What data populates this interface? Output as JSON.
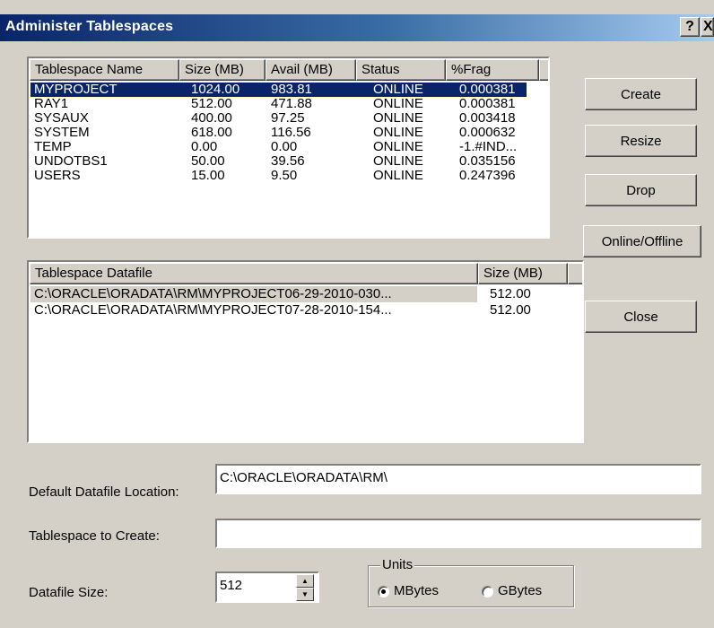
{
  "window": {
    "title": "Administer Tablespaces",
    "help_icon_glyph": "?",
    "close_icon_glyph": "X"
  },
  "tablespaces": {
    "columns": [
      "Tablespace Name",
      "Size (MB)",
      "Avail (MB)",
      "Status",
      "%Frag"
    ],
    "rows": [
      [
        "MYPROJECT",
        "1024.00",
        "983.81",
        "ONLINE",
        "0.000381"
      ],
      [
        "RAY1",
        "512.00",
        "471.88",
        "ONLINE",
        "0.000381"
      ],
      [
        "SYSAUX",
        "400.00",
        "97.25",
        "ONLINE",
        "0.003418"
      ],
      [
        "SYSTEM",
        "618.00",
        "116.56",
        "ONLINE",
        "0.000632"
      ],
      [
        "TEMP",
        "0.00",
        "0.00",
        "ONLINE",
        "-1.#IND..."
      ],
      [
        "UNDOTBS1",
        "50.00",
        "39.56",
        "ONLINE",
        "0.035156"
      ],
      [
        "USERS",
        "15.00",
        "9.50",
        "ONLINE",
        "0.247396"
      ]
    ],
    "selected_index": 0
  },
  "datafiles": {
    "columns": [
      "Tablespace Datafile",
      "Size (MB)"
    ],
    "rows": [
      [
        "C:\\ORACLE\\ORADATA\\RM\\MYPROJECT06-29-2010-030...",
        "512.00"
      ],
      [
        "C:\\ORACLE\\ORADATA\\RM\\MYPROJECT07-28-2010-154...",
        "512.00"
      ]
    ]
  },
  "buttons": {
    "create": "Create",
    "resize": "Resize",
    "drop": "Drop",
    "online_offline": "Online/Offline",
    "close": "Close"
  },
  "form": {
    "default_location_label": "Default Datafile Location:",
    "default_location_value": "C:\\ORACLE\\ORADATA\\RM\\",
    "tablespace_to_create_label": "Tablespace to Create:",
    "tablespace_to_create_value": "",
    "datafile_size_label": "Datafile Size:",
    "datafile_size_value": "512",
    "units_legend": "Units",
    "units_mbytes": "MBytes",
    "units_gbytes": "GBytes",
    "units_selected": "MBytes"
  },
  "colors": {
    "selection": "#0a246a",
    "dialog_bg": "#d4d0c8"
  }
}
